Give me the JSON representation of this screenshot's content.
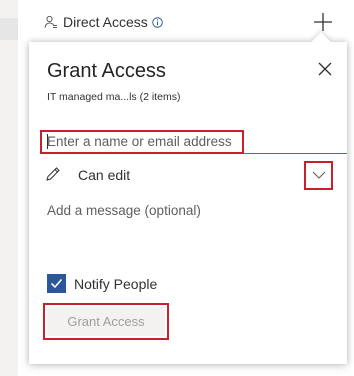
{
  "background": {
    "direct_access_label": "Direct Access",
    "icons": {
      "person": "person-icon",
      "info": "info-icon",
      "add": "plus-icon"
    }
  },
  "dialog": {
    "title": "Grant Access",
    "subtitle": "IT managed ma...ls (2 items)",
    "name_input": {
      "placeholder": "Enter a name or email address",
      "value": ""
    },
    "permission": {
      "label": "Can edit",
      "icon": "pencil-icon",
      "dropdown_icon": "chevron-down-icon"
    },
    "message": {
      "placeholder": "Add a message (optional)",
      "value": ""
    },
    "notify": {
      "label": "Notify People",
      "checked": true
    },
    "grant_button_label": "Grant Access",
    "close_icon": "close-icon"
  },
  "colors": {
    "accent": "#2b579a",
    "highlight": "#c8202c",
    "disabled_button_bg": "#f3f2f1",
    "disabled_button_text": "#a19f9d"
  }
}
